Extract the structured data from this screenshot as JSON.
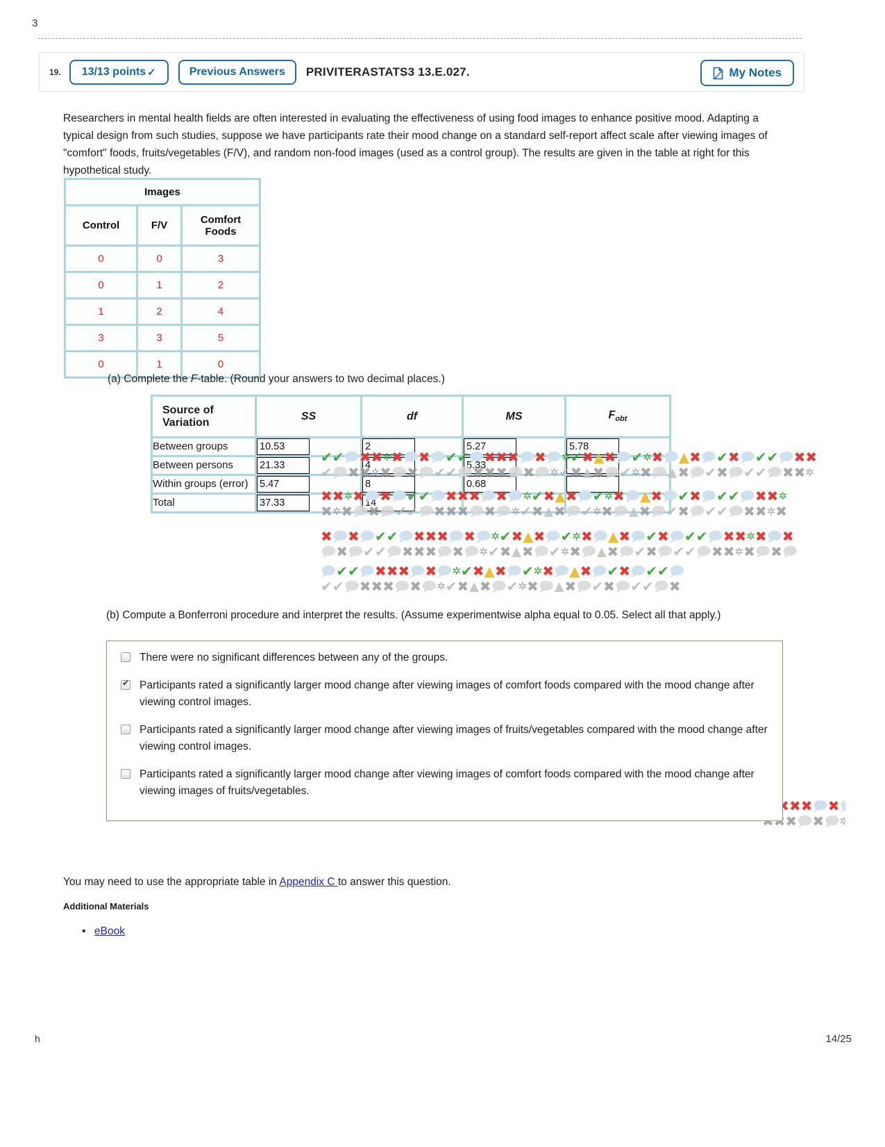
{
  "top_fragment": "3",
  "header": {
    "question_number": "19.",
    "points_label": "13/13 points",
    "points_check": "✓",
    "previous_answers_label": "Previous Answers",
    "question_code": "PRIVITERASTATS3 13.E.027.",
    "my_notes_label": "My Notes"
  },
  "prose": "Researchers in mental health fields are often interested in evaluating the effectiveness of using food images to enhance positive mood. Adapting a typical design from such studies, suppose we have participants rate their mood change on a standard self-report affect scale after viewing images of \"comfort\" foods, fruits/vegetables (F/V), and random non-food images (used as a control group). The results are given in the table at right for this hypothetical study.",
  "data_table": {
    "span_header": "Images",
    "columns": [
      "Control",
      "F/V",
      "Comfort Foods"
    ],
    "rows": [
      [
        "0",
        "0",
        "3"
      ],
      [
        "0",
        "1",
        "2"
      ],
      [
        "1",
        "2",
        "4"
      ],
      [
        "3",
        "3",
        "5"
      ],
      [
        "0",
        "1",
        "0"
      ]
    ],
    "value_color": "#d92121",
    "border_color": "#a9d5e4"
  },
  "part_a": {
    "prefix": "(a) Complete the ",
    "italic": "F",
    "suffix": "-table. (Round your answers to two decimal places.)"
  },
  "ftable": {
    "headers": [
      "Source of Variation",
      "SS",
      "df",
      "MS",
      "Fobt"
    ],
    "header_f_base": "F",
    "header_f_sub": "obt",
    "rows": [
      {
        "source": "Between groups",
        "ss": "10.53",
        "df": "2",
        "ms": "5.27",
        "f": "5.78"
      },
      {
        "source": "Between persons",
        "ss": "21.33",
        "df": "4",
        "ms": "5.33",
        "f": ""
      },
      {
        "source": "Within groups (error)",
        "ss": "5.47",
        "df": "8",
        "ms": "0.68",
        "f": ""
      },
      {
        "source": "Total",
        "ss": "37.33",
        "df": "14",
        "ms": "",
        "f": ""
      }
    ]
  },
  "part_b": {
    "text": "(b) Compute a Bonferroni procedure and interpret the results. (Assume experimentwise alpha equal to 0.05. Select all that apply.)",
    "choices": [
      {
        "checked": false,
        "label": "There were no significant differences between any of the groups."
      },
      {
        "checked": true,
        "label": "Participants rated a significantly larger mood change after viewing images of comfort foods compared with the mood change after viewing control images."
      },
      {
        "checked": false,
        "label": "Participants rated a significantly larger mood change after viewing images of fruits/vegetables compared with the mood change after viewing control images."
      },
      {
        "checked": false,
        "label": "Participants rated a significantly larger mood change after viewing images of comfort foods compared with the mood change after viewing images of fruits/vegetables."
      }
    ],
    "border_color": "#7fa45c"
  },
  "appendix": {
    "before": "You may need to use the appropriate table in ",
    "link": "Appendix C ",
    "after": "to answer this question."
  },
  "additional_materials": {
    "title": "Additional Materials",
    "items": [
      "eBook"
    ]
  },
  "footer": {
    "left": "h",
    "page": "14/25"
  },
  "icons": {
    "note": "note-page-icon",
    "check": "check-icon",
    "cross": "cross-icon",
    "asterisk": "asterisk-icon",
    "bubble": "speech-bubble-icon",
    "warning": "warning-triangle-icon"
  }
}
